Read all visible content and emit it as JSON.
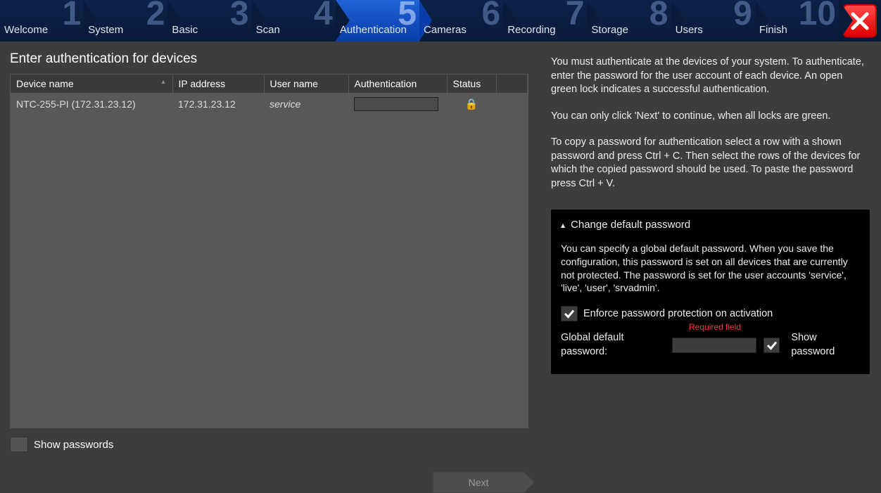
{
  "steps": [
    {
      "num": "1",
      "label": "Welcome"
    },
    {
      "num": "2",
      "label": "System"
    },
    {
      "num": "3",
      "label": "Basic"
    },
    {
      "num": "4",
      "label": "Scan"
    },
    {
      "num": "5",
      "label": "Authentication"
    },
    {
      "num": "6",
      "label": "Cameras"
    },
    {
      "num": "7",
      "label": "Recording"
    },
    {
      "num": "8",
      "label": "Storage"
    },
    {
      "num": "9",
      "label": "Users"
    },
    {
      "num": "10",
      "label": "Finish"
    }
  ],
  "active_step_index": 4,
  "page_title": "Enter authentication for devices",
  "columns": {
    "device_name": "Device name",
    "ip": "IP address",
    "user": "User name",
    "auth": "Authentication",
    "status": "Status"
  },
  "rows": [
    {
      "device_name": "NTC-255-PI (172.31.23.12)",
      "ip": "172.31.23.12",
      "user": "service",
      "auth": "",
      "status": "locked"
    }
  ],
  "show_passwords_label": "Show passwords",
  "next_label": "Next",
  "help": {
    "p1": "You must authenticate at the devices of your system. To authenticate, enter the password for the user account of each device. An open green lock indicates a successful authentication.",
    "p2": "You can only click 'Next' to continue, when all locks are green.",
    "p3": "To copy a password for authentication select a row with a shown password and press Ctrl + C. Then select the rows of the devices for which the copied password should be used. To paste the password press Ctrl + V."
  },
  "panel": {
    "title": "Change default password",
    "body": "You can specify a global default password. When you save the configuration, this password is set on all devices that are currently not protected. The password is set for the user accounts 'service', 'live', 'user', 'srvadmin'.",
    "enforce_label": "Enforce password protection on activation",
    "global_label": "Global default password:",
    "required": "Required field",
    "show_pw_label": "Show password"
  }
}
